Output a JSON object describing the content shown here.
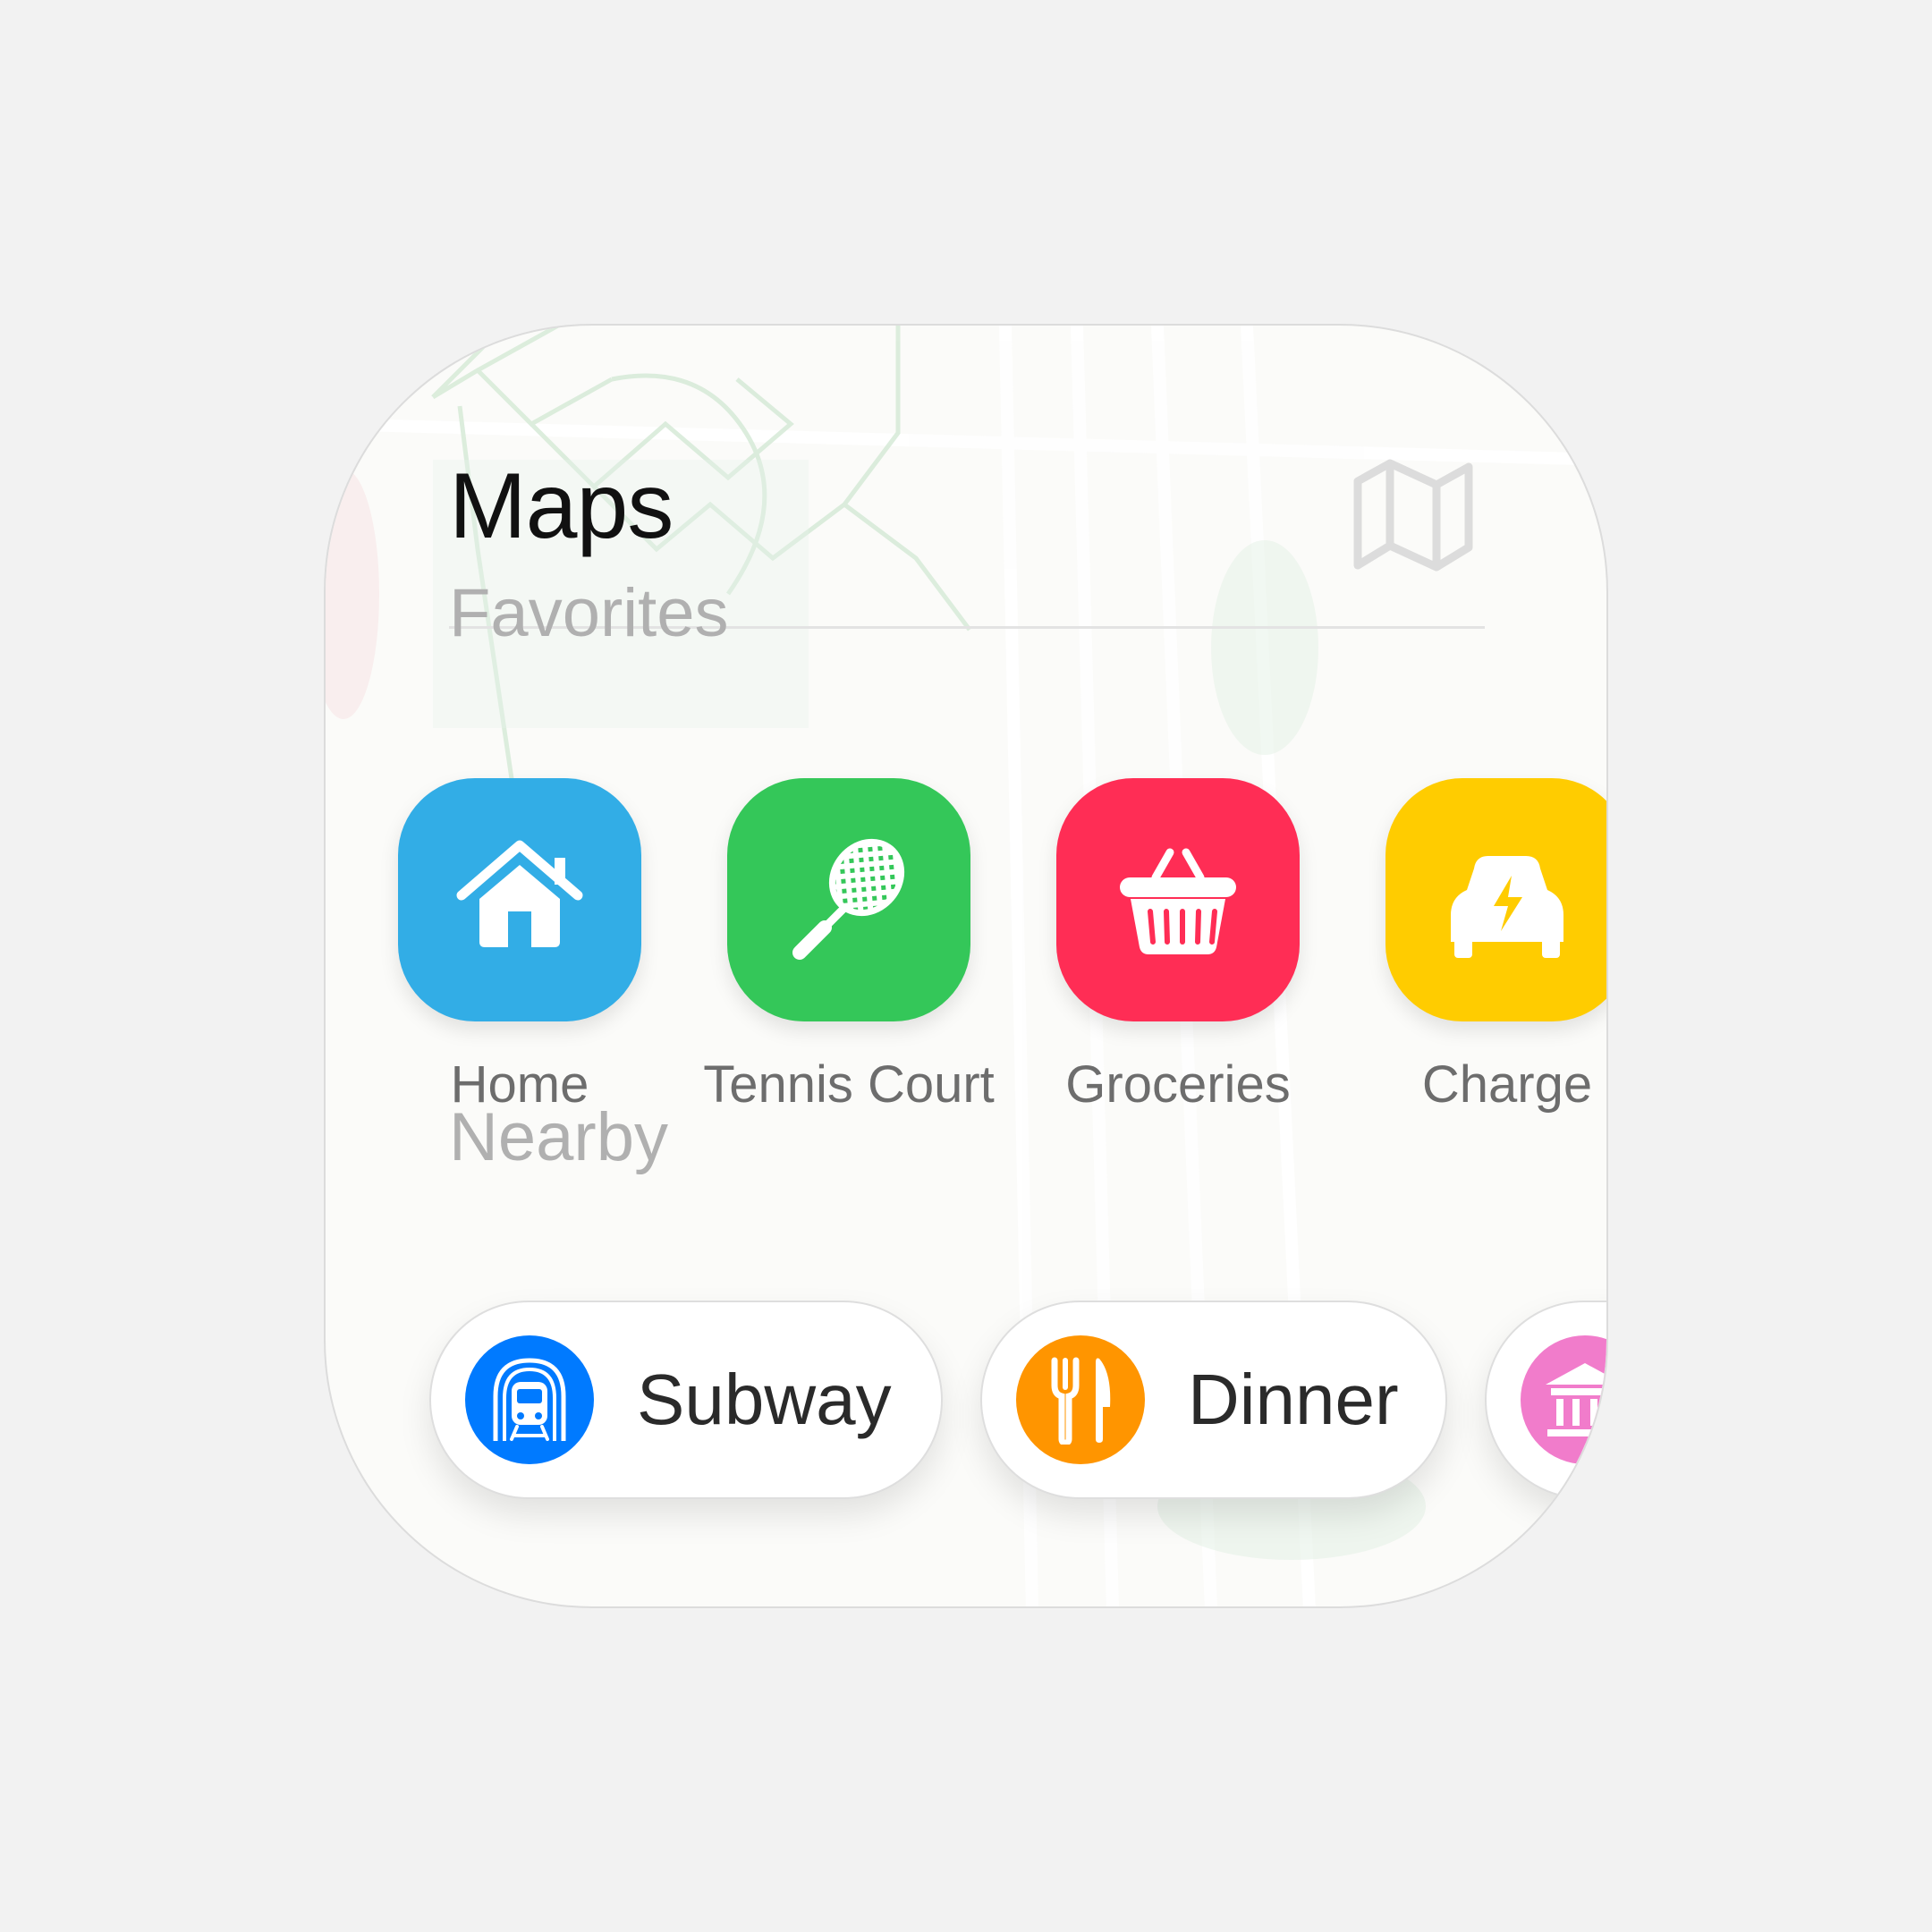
{
  "widget": {
    "title": "Maps",
    "favorites_label": "Favorites",
    "nearby_label": "Nearby",
    "favorites": [
      {
        "label": "Home",
        "icon": "house-icon",
        "color": "#32ADE6"
      },
      {
        "label": "Tennis Court",
        "icon": "tennis-racket-icon",
        "color": "#34C759"
      },
      {
        "label": "Groceries",
        "icon": "basket-icon",
        "color": "#FF2D55"
      },
      {
        "label": "Charge",
        "icon": "ev-charger-car-icon",
        "color": "#FFCC00"
      }
    ],
    "nearby": [
      {
        "label": "Subway",
        "icon": "tram-icon",
        "color": "#007AFF"
      },
      {
        "label": "Dinner",
        "icon": "fork-knife-icon",
        "color": "#FF9500"
      },
      {
        "label": "",
        "icon": "museum-icon",
        "color": "#F17CCB"
      }
    ]
  }
}
